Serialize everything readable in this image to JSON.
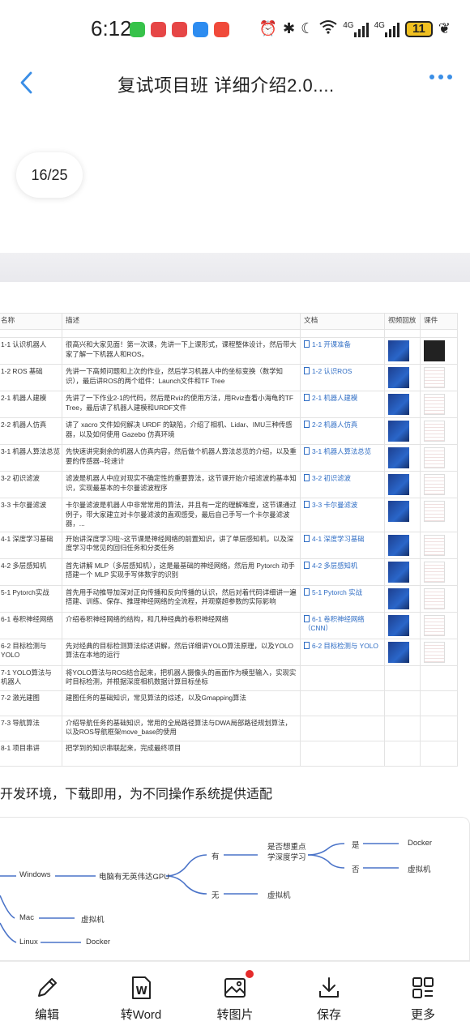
{
  "status_bar": {
    "time": "6:12",
    "network_label_1": "4G",
    "network_label_2": "4G",
    "battery": "11",
    "app_icon_colors": [
      "#37c24a",
      "#e64646",
      "#e64646",
      "#2d8cf0",
      "#f04a3a"
    ]
  },
  "header": {
    "title": "复试项目班 详细介绍2.0....",
    "page_indicator": "16/25"
  },
  "table": {
    "columns": [
      "名称",
      "描述",
      "文档",
      "视频回放",
      "课件"
    ],
    "rows": [
      {
        "name": "1-1 认识机器人",
        "desc": "很高兴和大家见面！第一次课，先讲一下上课形式，课程整体设计，然后带大家了解一下机器人和ROS。",
        "doc": "1-1 开课准备"
      },
      {
        "name": "1-2 ROS 基础",
        "desc": "先讲一下高频问题和上次的作业，然后学习机器人中的坐标变换（数学知识），最后讲ROS的两个组件：Launch文件和TF Tree",
        "doc": "1-2 认识ROS"
      },
      {
        "name": "2-1 机器人建模",
        "desc": "先讲了一下作业2-1的代码，然后是Rviz的使用方法，用Rviz查看小海龟的TF Tree，最后讲了机器人建模和URDF文件",
        "doc": "2-1 机器人建模"
      },
      {
        "name": "2-2 机器人仿真",
        "desc": "讲了 xacro 文件如何解决 URDF 的缺陷，介绍了相机、Lidar、IMU三种传感器，以及如何使用 Gazebo 仿真环境",
        "doc": "2-2 机器人仿真"
      },
      {
        "name": "3-1 机器人算法总览",
        "desc": "先快速讲完剩余的机器人仿真内容，然后做个机器人算法总览的介绍，以及重要的传感器--轮速计",
        "doc": "3-1 机器人算法总览"
      },
      {
        "name": "3-2 初识滤波",
        "desc": "滤波是机器人中应对现实不确定性的重要算法，这节课开始介绍滤波的基本知识，实现最基本的卡尔曼滤波程序",
        "doc": "3-2 初识滤波"
      },
      {
        "name": "3-3 卡尔曼滤波",
        "desc": "卡尔曼滤波是机器人中非常常用的算法，并且有一定的理解难度，这节课通过例子，带大家建立对卡尔曼滤波的直观感受，最后自己手写一个卡尔曼滤波器，...",
        "doc": "3-3 卡尔曼滤波"
      },
      {
        "name": "4-1 深度学习基础",
        "desc": "开始讲深度学习啦~这节课是神经网络的前置知识，讲了单层感知机，以及深度学习中常见的回归任务和分类任务",
        "doc": "4-1 深度学习基础"
      },
      {
        "name": "4-2 多层感知机",
        "desc": "首先讲解 MLP（多层感知机），这是最基础的神经网络，然后用 Pytorch 动手搭建一个 MLP 实现手写体数字的识别",
        "doc": "4-2 多层感知机"
      },
      {
        "name": "5-1 Pytorch实战",
        "desc": "首先用手动推导加深对正向传播和反向传播的认识，然后对着代码详细讲一遍搭建、训练、保存、推理神经网络的全流程，并观察超参数的实际影响",
        "doc": "5-1 Pytorch 实战"
      },
      {
        "name": "6-1 卷积神经网络",
        "desc": "介绍卷积神经网络的结构，和几种经典的卷积神经网络",
        "doc": "6-1 卷积神经网络（CNN）"
      },
      {
        "name": "6-2 目标检测与YOLO",
        "desc": "先对经典的目标检测算法综述讲解，然后详细讲YOLO算法原理，以及YOLO算法在本地的运行",
        "doc": "6-2 目标检测与 YOLO"
      },
      {
        "name": "7-1 YOLO算法与机器人",
        "desc": "将YOLO算法与ROS结合起来，把机器人摄像头的画面作为模型输入，实现实时目标检测，并根据深度相机数据计算目标坐标",
        "doc": ""
      },
      {
        "name": "7-2 激光建图",
        "desc": "建图任务的基础知识，常见算法的综述，以及Gmapping算法",
        "doc": ""
      },
      {
        "name": "7-3 导航算法",
        "desc": "介绍导航任务的基础知识，常用的全局路径算法与DWA局部路径规划算法，以及ROS导航框架move_base的使用",
        "doc": ""
      },
      {
        "name": "8-1 项目串讲",
        "desc": "把学到的知识串联起来，完成最终项目",
        "doc": ""
      }
    ]
  },
  "section": {
    "heading": "开发环境，下载即用，为不同操作系统提供适配"
  },
  "mindmap": {
    "windows": "Windows",
    "gpu_question": "电脑有无英伟达GPU",
    "yes": "有",
    "no": "无",
    "dl_question": "是否想重点学深度学习",
    "yes2": "是",
    "no2": "否",
    "docker": "Docker",
    "vm": "虚拟机",
    "vm2": "虚拟机",
    "mac": "Mac",
    "mac_vm": "虚拟机",
    "linux": "Linux",
    "linux_docker": "Docker"
  },
  "toolbar": {
    "edit": "编辑",
    "to_word": "转Word",
    "to_image": "转图片",
    "save": "保存",
    "more": "更多"
  }
}
